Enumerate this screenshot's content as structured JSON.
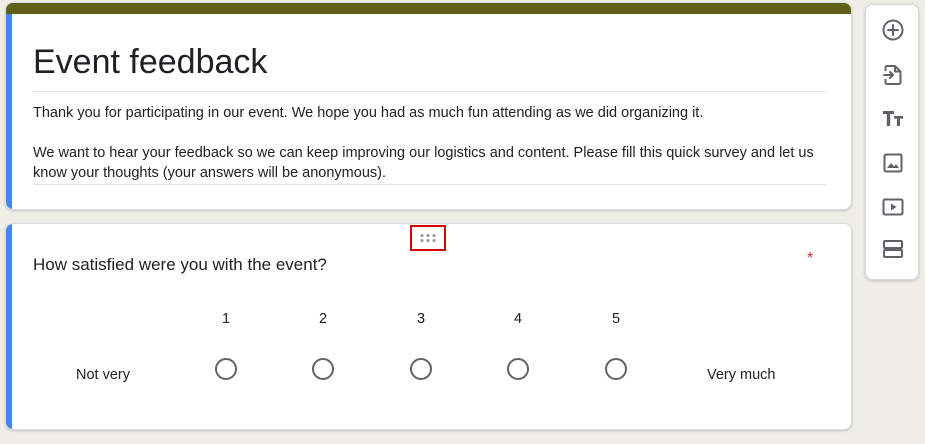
{
  "form": {
    "title": "Event feedback",
    "description": "Thank you for participating in our event. We hope you had as much fun attending as we did organizing it.\n\nWe want to hear your feedback so we can keep improving our logistics and content. Please fill this quick survey and let us know your thoughts (your answers will be anonymous).",
    "accent_color": "#5f6119",
    "highlight_color": "#4285f4"
  },
  "question": {
    "text": "How satisfied were you with the event?",
    "required_mark": "*",
    "low_label": "Not very",
    "high_label": "Very much",
    "scale": [
      "1",
      "2",
      "3",
      "4",
      "5"
    ]
  },
  "toolbar": {
    "items": [
      {
        "name": "add-question",
        "icon": "add-circle-icon"
      },
      {
        "name": "import-questions",
        "icon": "import-icon"
      },
      {
        "name": "add-title-description",
        "icon": "text-title-icon"
      },
      {
        "name": "add-image",
        "icon": "image-icon"
      },
      {
        "name": "add-video",
        "icon": "video-icon"
      },
      {
        "name": "add-section",
        "icon": "section-icon"
      }
    ]
  }
}
